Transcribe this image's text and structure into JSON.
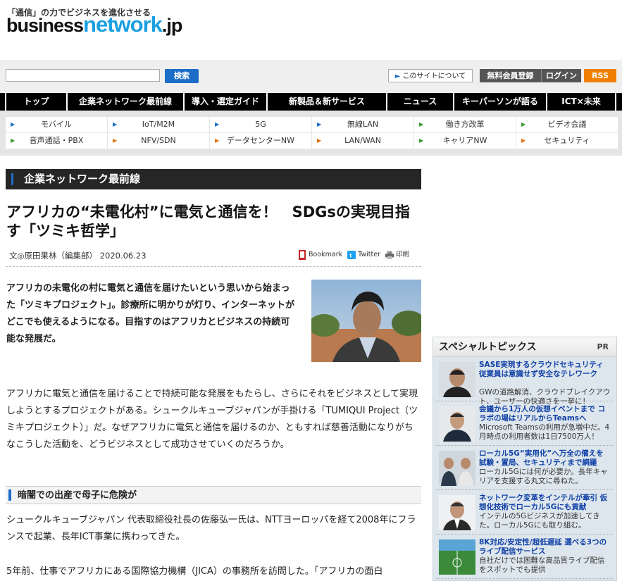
{
  "header": {
    "tagline": "「通信」の力でビジネスを進化させる",
    "logo_prefix": "business",
    "logo_network": "network",
    "logo_suffix": ".jp"
  },
  "search": {
    "placeholder": "",
    "value": "",
    "button": "検索"
  },
  "utility": {
    "about": "このサイトについて",
    "register": "無料会員登録",
    "login": "ログイン",
    "rss": "RSS"
  },
  "nav": {
    "items": [
      "トップ",
      "企業ネットワーク最前線",
      "導入・選定ガイド",
      "新製品＆新サービス",
      "ニュース",
      "キーパーソンが語る",
      "ICT×未来"
    ]
  },
  "subnav": {
    "items": [
      "モバイル",
      "IoT/M2M",
      "5G",
      "無線LAN",
      "働き方改革",
      "ビデオ会議",
      "音声通話・PBX",
      "NFV/SDN",
      "データセンターNW",
      "LAN/WAN",
      "キャリアNW",
      "セキュリティ"
    ]
  },
  "section": {
    "title": "企業ネットワーク最前線"
  },
  "article": {
    "title": "アフリカの“未電化村”に電気と通信を！　SDGsの実現目指す「ツミキ哲学」",
    "byline": "文◎原田果林（編集部）  2020.06.23",
    "share": {
      "bookmark": "Bookmark",
      "twitter": "Twitter",
      "print": "印刷"
    },
    "lead": "アフリカの未電化の村に電気と通信を届けたいという思いから始まった「ツミキプロジェクト」。診療所に明かりが灯り、インターネットがどこでも使えるようになる。目指すのはアフリカとビジネスの持続可能な発展だ。",
    "para1": "アフリカに電気と通信を届けることで持続可能な発展をもたらし、さらにそれをビジネスとして実現しようとするプロジェクトがある。シュークルキューブジャパンが手掛ける「TUMIQUI Project（ツミキプロジェクト）」だ。なぜアフリカに電気と通信を届けるのか、ともすれば慈善活動になりがちなこうした活動を、どうビジネスとして成功させていくのだろうか。",
    "heading": "暗闇での出産で母子に危険が",
    "para2": "シュークルキューブジャパン 代表取締役社長の佐藤弘一氏は、NTTヨーロッパを経て2008年にフランスで起業、長年ICT事業に携わってきた。",
    "para3": "5年前、仕事でアフリカにある国際協力機構（JICA）の事務所を訪問した。「アフリカの面白"
  },
  "sidebar": {
    "title": "スペシャルトピックス",
    "pr": "PR",
    "items": [
      {
        "title": "SASE実現するクラウドセキュリティ 従業員は意識せず安全なテレワーク",
        "desc": "GWの道路解消、クラウドブレイクアウト、ユーザーの快適さを一挙に！"
      },
      {
        "title": "会議から1万人の仮想イベントまで コラボの場はリアルからTeamsへ",
        "desc": "Microsoft Teamsの利用が急増中だ。4月時点の利用者数は1日7500万人！"
      },
      {
        "title": "ローカル5G“実用化”へ万全の備えを 試験・置局、セキュリティまで網羅",
        "desc": "ローカル5Gには何が必要か。長年キャリアを支援する丸文に尋ねた。"
      },
      {
        "title": "ネットワーク変革をインテルが牽引 仮想化技術でローカル5Gにも貢献",
        "desc": "インテルの5Gビジネスが加速してきた。ローカル5Gにも取り組む。"
      },
      {
        "title": "8K対応/安定性/超低遅延 選べる3つのライブ配信サービス",
        "desc": "自社だけでは困難な高品質ライブ配信をスポットでも提供"
      }
    ]
  },
  "colors": {
    "accent": "#1c6dc8",
    "rss": "#f08000",
    "nav_bg": "#000000",
    "logo_network": "#1a9fe0"
  }
}
